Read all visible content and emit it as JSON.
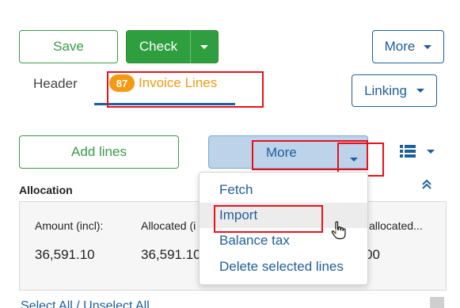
{
  "toolbar": {
    "save_label": "Save",
    "check_label": "Check",
    "more_label": "More"
  },
  "tabs": [
    {
      "label": "Header"
    },
    {
      "label": "Invoice Lines",
      "badge": "87",
      "active": true
    }
  ],
  "linking_label": "Linking",
  "lines_toolbar": {
    "add_lines_label": "Add lines",
    "more_label": "More"
  },
  "allocation": {
    "title": "Allocation",
    "columns": [
      {
        "label": "Amount (incl):",
        "value": "36,591.10"
      },
      {
        "label": "Allocated (i",
        "value": "36,591.10"
      },
      {
        "label": "allocated...",
        "value": "00"
      }
    ]
  },
  "more_menu": {
    "items": [
      "Fetch",
      "Import",
      "Balance tax",
      "Delete selected lines"
    ],
    "hovered": "Import"
  },
  "footer": {
    "select_all": "Select All",
    "separator": "/",
    "unselect_all": "Unselect All"
  },
  "colors": {
    "primary": "#1f5f99",
    "success": "#2e9e3e",
    "badge": "#f29a12",
    "highlight": "#e8121b"
  },
  "icons": {
    "view_toggle": "list-icon",
    "collapse": "chevron-up-double-icon",
    "cursor": "hand-pointer-icon"
  }
}
